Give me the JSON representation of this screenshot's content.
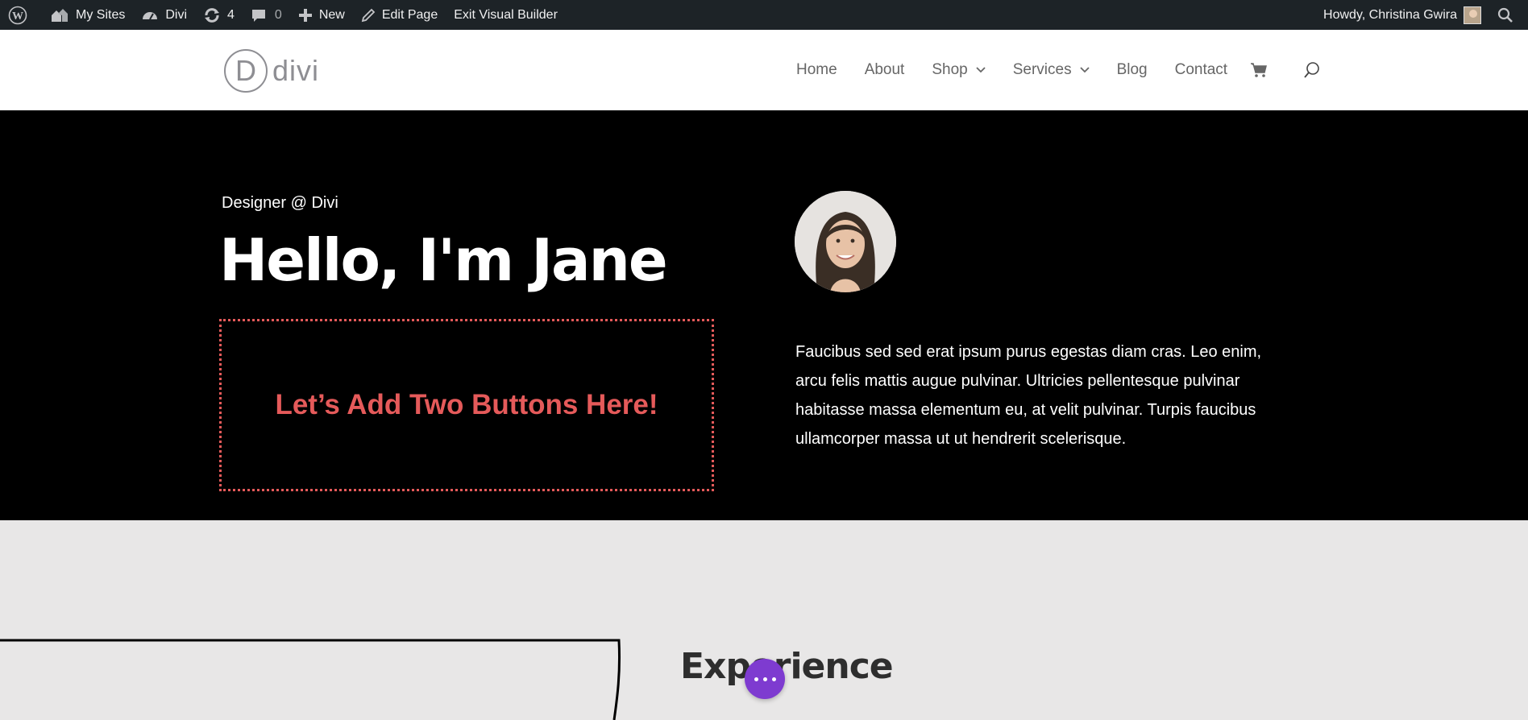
{
  "adminbar": {
    "my_sites": "My Sites",
    "site_name": "Divi",
    "updates_count": "4",
    "comments_count": "0",
    "new_label": "New",
    "edit_page": "Edit Page",
    "exit_builder": "Exit Visual Builder",
    "howdy": "Howdy, Christina Gwira"
  },
  "header": {
    "logo_letter": "D",
    "logo_text": "divi",
    "nav": [
      {
        "label": "Home"
      },
      {
        "label": "About"
      },
      {
        "label": "Shop"
      },
      {
        "label": "Services"
      },
      {
        "label": "Blog"
      },
      {
        "label": "Contact"
      }
    ]
  },
  "hero": {
    "subtitle": "Designer @ Divi",
    "headline": "Hello, I'm Jane",
    "placeholder": "Let’s Add Two Buttons Here!",
    "bio": "Faucibus sed sed erat ipsum purus egestas diam cras. Leo enim, arcu felis mattis augue pulvinar. Ultricies pellentesque pulvinar habitasse massa elementum eu, at velit pulvinar. Turpis faucibus ullamcorper massa ut ut hendrerit scelerisque."
  },
  "section2": {
    "heading": "Experience"
  },
  "colors": {
    "admin_bar": "#1d2327",
    "accent_red": "#e55a5a",
    "builder_purple": "#7e3bd0"
  }
}
